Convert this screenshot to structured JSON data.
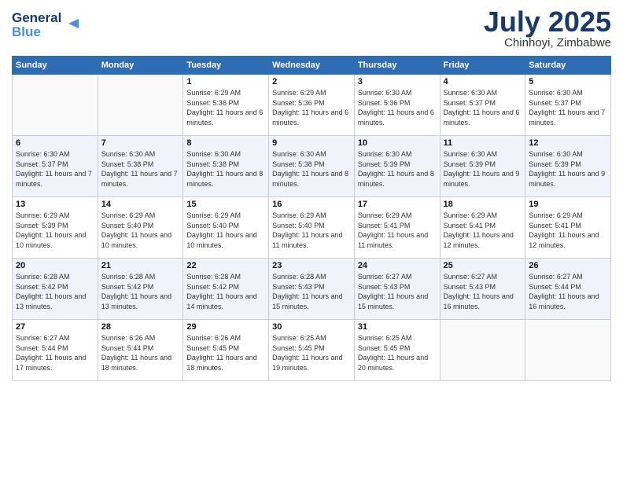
{
  "logo": {
    "line1": "General",
    "line2": "Blue"
  },
  "header": {
    "month": "July 2025",
    "location": "Chinhoyi, Zimbabwe"
  },
  "weekdays": [
    "Sunday",
    "Monday",
    "Tuesday",
    "Wednesday",
    "Thursday",
    "Friday",
    "Saturday"
  ],
  "weeks": [
    [
      {
        "day": "",
        "info": ""
      },
      {
        "day": "",
        "info": ""
      },
      {
        "day": "1",
        "info": "Sunrise: 6:29 AM\nSunset: 5:36 PM\nDaylight: 11 hours and 6 minutes."
      },
      {
        "day": "2",
        "info": "Sunrise: 6:29 AM\nSunset: 5:36 PM\nDaylight: 11 hours and 6 minutes."
      },
      {
        "day": "3",
        "info": "Sunrise: 6:30 AM\nSunset: 5:36 PM\nDaylight: 11 hours and 6 minutes."
      },
      {
        "day": "4",
        "info": "Sunrise: 6:30 AM\nSunset: 5:37 PM\nDaylight: 11 hours and 6 minutes."
      },
      {
        "day": "5",
        "info": "Sunrise: 6:30 AM\nSunset: 5:37 PM\nDaylight: 11 hours and 7 minutes."
      }
    ],
    [
      {
        "day": "6",
        "info": "Sunrise: 6:30 AM\nSunset: 5:37 PM\nDaylight: 11 hours and 7 minutes."
      },
      {
        "day": "7",
        "info": "Sunrise: 6:30 AM\nSunset: 5:38 PM\nDaylight: 11 hours and 7 minutes."
      },
      {
        "day": "8",
        "info": "Sunrise: 6:30 AM\nSunset: 5:38 PM\nDaylight: 11 hours and 8 minutes."
      },
      {
        "day": "9",
        "info": "Sunrise: 6:30 AM\nSunset: 5:38 PM\nDaylight: 11 hours and 8 minutes."
      },
      {
        "day": "10",
        "info": "Sunrise: 6:30 AM\nSunset: 5:39 PM\nDaylight: 11 hours and 8 minutes."
      },
      {
        "day": "11",
        "info": "Sunrise: 6:30 AM\nSunset: 5:39 PM\nDaylight: 11 hours and 9 minutes."
      },
      {
        "day": "12",
        "info": "Sunrise: 6:30 AM\nSunset: 5:39 PM\nDaylight: 11 hours and 9 minutes."
      }
    ],
    [
      {
        "day": "13",
        "info": "Sunrise: 6:29 AM\nSunset: 5:39 PM\nDaylight: 11 hours and 10 minutes."
      },
      {
        "day": "14",
        "info": "Sunrise: 6:29 AM\nSunset: 5:40 PM\nDaylight: 11 hours and 10 minutes."
      },
      {
        "day": "15",
        "info": "Sunrise: 6:29 AM\nSunset: 5:40 PM\nDaylight: 11 hours and 10 minutes."
      },
      {
        "day": "16",
        "info": "Sunrise: 6:29 AM\nSunset: 5:40 PM\nDaylight: 11 hours and 11 minutes."
      },
      {
        "day": "17",
        "info": "Sunrise: 6:29 AM\nSunset: 5:41 PM\nDaylight: 11 hours and 11 minutes."
      },
      {
        "day": "18",
        "info": "Sunrise: 6:29 AM\nSunset: 5:41 PM\nDaylight: 11 hours and 12 minutes."
      },
      {
        "day": "19",
        "info": "Sunrise: 6:29 AM\nSunset: 5:41 PM\nDaylight: 11 hours and 12 minutes."
      }
    ],
    [
      {
        "day": "20",
        "info": "Sunrise: 6:28 AM\nSunset: 5:42 PM\nDaylight: 11 hours and 13 minutes."
      },
      {
        "day": "21",
        "info": "Sunrise: 6:28 AM\nSunset: 5:42 PM\nDaylight: 11 hours and 13 minutes."
      },
      {
        "day": "22",
        "info": "Sunrise: 6:28 AM\nSunset: 5:42 PM\nDaylight: 11 hours and 14 minutes."
      },
      {
        "day": "23",
        "info": "Sunrise: 6:28 AM\nSunset: 5:43 PM\nDaylight: 11 hours and 15 minutes."
      },
      {
        "day": "24",
        "info": "Sunrise: 6:27 AM\nSunset: 5:43 PM\nDaylight: 11 hours and 15 minutes."
      },
      {
        "day": "25",
        "info": "Sunrise: 6:27 AM\nSunset: 5:43 PM\nDaylight: 11 hours and 16 minutes."
      },
      {
        "day": "26",
        "info": "Sunrise: 6:27 AM\nSunset: 5:44 PM\nDaylight: 11 hours and 16 minutes."
      }
    ],
    [
      {
        "day": "27",
        "info": "Sunrise: 6:27 AM\nSunset: 5:44 PM\nDaylight: 11 hours and 17 minutes."
      },
      {
        "day": "28",
        "info": "Sunrise: 6:26 AM\nSunset: 5:44 PM\nDaylight: 11 hours and 18 minutes."
      },
      {
        "day": "29",
        "info": "Sunrise: 6:26 AM\nSunset: 5:45 PM\nDaylight: 11 hours and 18 minutes."
      },
      {
        "day": "30",
        "info": "Sunrise: 6:25 AM\nSunset: 5:45 PM\nDaylight: 11 hours and 19 minutes."
      },
      {
        "day": "31",
        "info": "Sunrise: 6:25 AM\nSunset: 5:45 PM\nDaylight: 11 hours and 20 minutes."
      },
      {
        "day": "",
        "info": ""
      },
      {
        "day": "",
        "info": ""
      }
    ]
  ]
}
